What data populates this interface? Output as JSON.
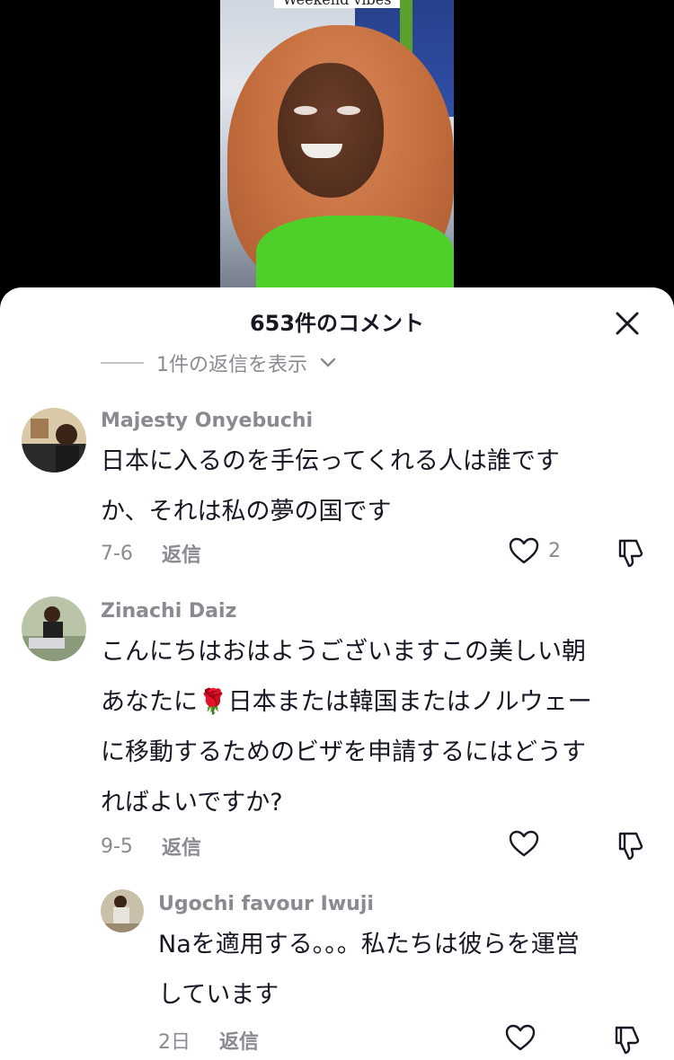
{
  "video": {
    "caption": "Weekend vibes"
  },
  "sheet": {
    "title": "653件のコメント",
    "view_replies": "1件の返信を表示"
  },
  "comments": [
    {
      "username": "Majesty Onyebuchi",
      "text_lines": [
        "日本に入るのを手伝ってくれる人は誰です",
        "か、それは私の夢の国です"
      ],
      "date": "7-6",
      "reply_label": "返信",
      "likes": "2"
    },
    {
      "username": "Zinachi Daiz",
      "text_lines": [
        "こんにちはおはようございますこの美しい朝",
        "あなたに🌹日本または韓国またはノルウェー",
        "に移動するためのビザを申請するにはどうす",
        "ればよいですか?"
      ],
      "date": "9-5",
      "reply_label": "返信",
      "likes": ""
    }
  ],
  "reply": {
    "username": "Ugochi favour Iwuji",
    "text_lines": [
      "Naを適用する。。。私たちは彼らを運営",
      "しています"
    ],
    "date": "2日",
    "reply_label": "返信"
  },
  "icons": {
    "close": "close-icon",
    "like": "heart-icon",
    "dislike": "thumbs-down-icon",
    "expand": "chevron-down-icon"
  }
}
